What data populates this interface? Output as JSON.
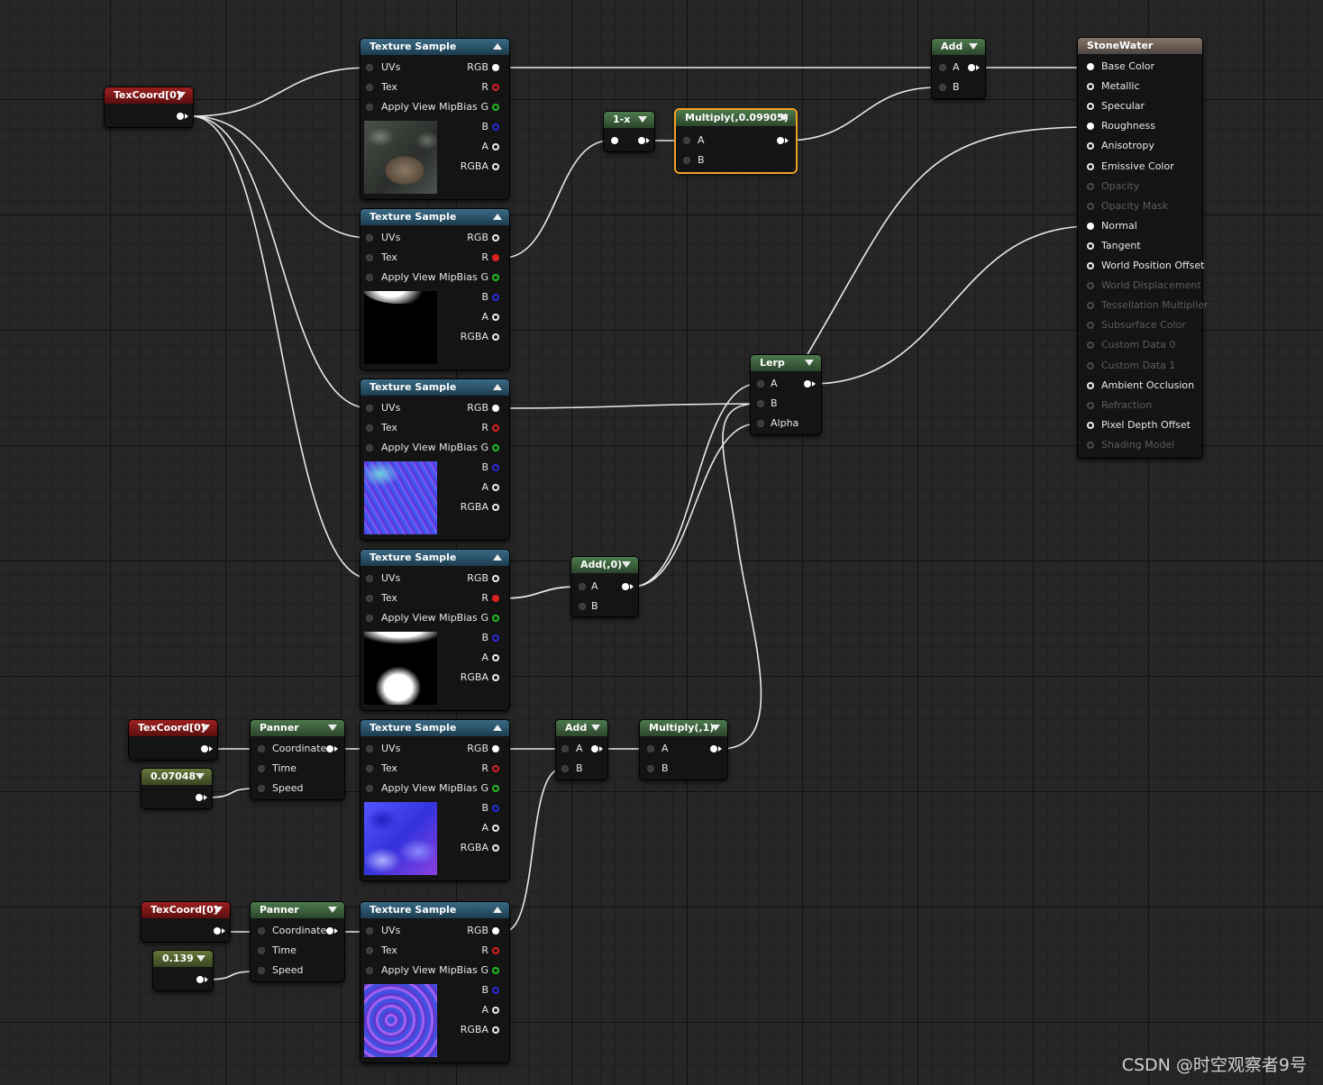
{
  "graph": {
    "tex_samples": [
      {
        "title": "Texture Sample",
        "inputs": [
          "UVs",
          "Tex",
          "Apply View MipBias"
        ],
        "outputs": [
          "RGB",
          "R",
          "G",
          "B",
          "A",
          "RGBA"
        ],
        "thumb": "stone-texture"
      },
      {
        "title": "Texture Sample",
        "inputs": [
          "UVs",
          "Tex",
          "Apply View MipBias"
        ],
        "outputs": [
          "RGB",
          "R",
          "G",
          "B",
          "A",
          "RGBA"
        ],
        "thumb": "grayscale-mask"
      },
      {
        "title": "Texture Sample",
        "inputs": [
          "UVs",
          "Tex",
          "Apply View MipBias"
        ],
        "outputs": [
          "RGB",
          "R",
          "G",
          "B",
          "A",
          "RGBA"
        ],
        "thumb": "normal-map"
      },
      {
        "title": "Texture Sample",
        "inputs": [
          "UVs",
          "Tex",
          "Apply View MipBias"
        ],
        "outputs": [
          "RGB",
          "R",
          "G",
          "B",
          "A",
          "RGBA"
        ],
        "thumb": "grayscale-mask"
      },
      {
        "title": "Texture Sample",
        "inputs": [
          "UVs",
          "Tex",
          "Apply View MipBias"
        ],
        "outputs": [
          "RGB",
          "R",
          "G",
          "B",
          "A",
          "RGBA"
        ],
        "thumb": "water-normal"
      },
      {
        "title": "Texture Sample",
        "inputs": [
          "UVs",
          "Tex",
          "Apply View MipBias"
        ],
        "outputs": [
          "RGB",
          "R",
          "G",
          "B",
          "A",
          "RGBA"
        ],
        "thumb": "water-normal"
      }
    ],
    "texcoords": [
      "TexCoord[0]",
      "TexCoord[0]",
      "TexCoord[0]"
    ],
    "constants": [
      "0.07048",
      "0.139"
    ],
    "panners": [
      {
        "title": "Panner",
        "inputs": [
          "Coordinate",
          "Time",
          "Speed"
        ]
      },
      {
        "title": "Panner",
        "inputs": [
          "Coordinate",
          "Time",
          "Speed"
        ]
      }
    ],
    "one_minus": {
      "title": "1-x"
    },
    "multiply_top": {
      "title": "Multiply(,0.09905)",
      "inputs": [
        "A",
        "B"
      ]
    },
    "add_top": {
      "title": "Add",
      "inputs": [
        "A",
        "B"
      ]
    },
    "add_zero": {
      "title": "Add(,0)",
      "inputs": [
        "A",
        "B"
      ]
    },
    "add_bottom": {
      "title": "Add",
      "inputs": [
        "A",
        "B"
      ]
    },
    "multiply_one": {
      "title": "Multiply(,1)",
      "inputs": [
        "A",
        "B"
      ]
    },
    "lerp": {
      "title": "Lerp",
      "inputs": [
        "A",
        "B",
        "Alpha"
      ]
    },
    "material": {
      "title": "StoneWater",
      "pins": [
        {
          "label": "Base Color",
          "enabled": true,
          "connected": true
        },
        {
          "label": "Metallic",
          "enabled": true,
          "connected": false
        },
        {
          "label": "Specular",
          "enabled": true,
          "connected": false
        },
        {
          "label": "Roughness",
          "enabled": true,
          "connected": true
        },
        {
          "label": "Anisotropy",
          "enabled": true,
          "connected": false
        },
        {
          "label": "Emissive Color",
          "enabled": true,
          "connected": false
        },
        {
          "label": "Opacity",
          "enabled": false,
          "connected": false
        },
        {
          "label": "Opacity Mask",
          "enabled": false,
          "connected": false
        },
        {
          "label": "Normal",
          "enabled": true,
          "connected": true
        },
        {
          "label": "Tangent",
          "enabled": true,
          "connected": false
        },
        {
          "label": "World Position Offset",
          "enabled": true,
          "connected": false
        },
        {
          "label": "World Displacement",
          "enabled": false,
          "connected": false
        },
        {
          "label": "Tessellation Multiplier",
          "enabled": false,
          "connected": false
        },
        {
          "label": "Subsurface Color",
          "enabled": false,
          "connected": false
        },
        {
          "label": "Custom Data 0",
          "enabled": false,
          "connected": false
        },
        {
          "label": "Custom Data 1",
          "enabled": false,
          "connected": false
        },
        {
          "label": "Ambient Occlusion",
          "enabled": true,
          "connected": false
        },
        {
          "label": "Refraction",
          "enabled": false,
          "connected": false
        },
        {
          "label": "Pixel Depth Offset",
          "enabled": true,
          "connected": false
        },
        {
          "label": "Shading Model",
          "enabled": false,
          "connected": false
        }
      ]
    }
  },
  "watermark": "CSDN @时空观察者9号"
}
